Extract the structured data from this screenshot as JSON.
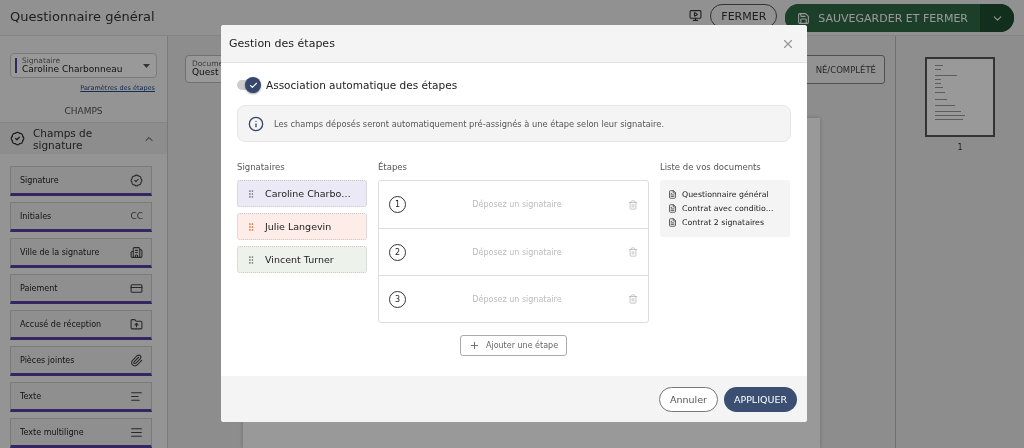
{
  "header": {
    "title": "Questionnaire général",
    "close_button": "FERMER",
    "save_button": "SAUVEGARDER ET FERMER"
  },
  "sidebar": {
    "signer_select": {
      "label": "Signataire",
      "value": "Caroline Charbonneau"
    },
    "steps_link": "Paramètres des étapes",
    "section_title": "CHAMPS",
    "group": {
      "title": "Champs de signature",
      "expanded": true
    },
    "fields": [
      {
        "label": "Signature"
      },
      {
        "label": "Initiales",
        "badge": "CC"
      },
      {
        "label": "Ville de la signature"
      },
      {
        "label": "Paiement"
      },
      {
        "label": "Accusé de réception"
      },
      {
        "label": "Pièces jointes"
      },
      {
        "label": "Texte"
      },
      {
        "label": "Texte multiligne"
      }
    ]
  },
  "toolbar": {
    "document_select": {
      "label": "Docume",
      "value": "Quest"
    },
    "status_button": "NÉ/COMPLÉTÉ"
  },
  "thumbnails": [
    {
      "page": "1"
    }
  ],
  "dialog": {
    "title": "Gestion des étapes",
    "auto_association": {
      "label": "Association automatique des étapes",
      "on": true
    },
    "info": "Les champs déposés seront automatiquement pré-assignés à une étape selon leur signataire.",
    "signers_heading": "Signataires",
    "signers": [
      {
        "name": "Caroline Charbo…",
        "color": "#ece9f6"
      },
      {
        "name": "Julie Langevin",
        "color": "#fdece8"
      },
      {
        "name": "Vincent Turner",
        "color": "#edf3ea"
      }
    ],
    "steps_heading": "Étapes",
    "steps": [
      {
        "number": "1",
        "drop_hint": "Déposez un signataire"
      },
      {
        "number": "2",
        "drop_hint": "Déposez un signataire"
      },
      {
        "number": "3",
        "drop_hint": "Déposez un signataire"
      }
    ],
    "add_step": "Ajouter une étape",
    "documents_heading": "Liste de vos documents",
    "documents": [
      "Questionnaire général",
      "Contrat avec conditio…",
      "Contrat 2 signataires"
    ],
    "cancel": "Annuler",
    "apply": "APPLIQUER"
  }
}
